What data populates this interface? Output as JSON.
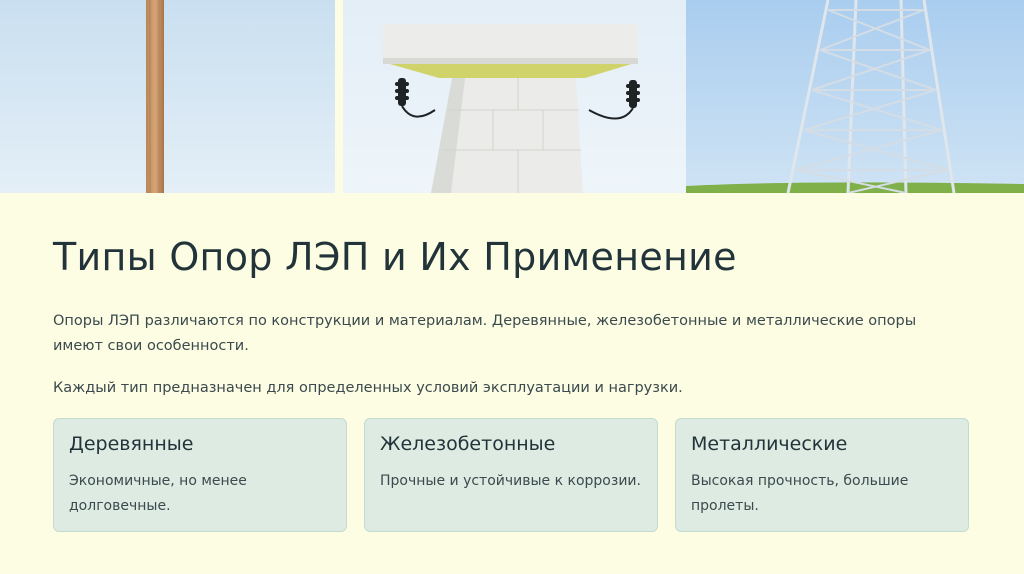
{
  "images": {
    "wood": "wooden-power-pole-photo",
    "concrete": "concrete-power-pole-photo",
    "metal": "metal-lattice-tower-photo"
  },
  "slide": {
    "title": "Типы Опор ЛЭП и Их Применение",
    "paragraph_1": "Опоры ЛЭП различаются по конструкции и материалам. Деревянные, железобетонные и металлические опоры имеют свои особенности.",
    "paragraph_2": "Каждый тип предназначен для определенных условий эксплуатации и нагрузки."
  },
  "cards": [
    {
      "title": "Деревянные",
      "description": "Экономичные, но менее долговечные."
    },
    {
      "title": "Железобетонные",
      "description": "Прочные и устойчивые к коррозии."
    },
    {
      "title": "Металлические",
      "description": "Высокая прочность, большие пролеты."
    }
  ],
  "colors": {
    "background": "#fdfde3",
    "card": "#ddebe2",
    "text_dark": "#22343a",
    "text_body": "#3b4a4e"
  }
}
